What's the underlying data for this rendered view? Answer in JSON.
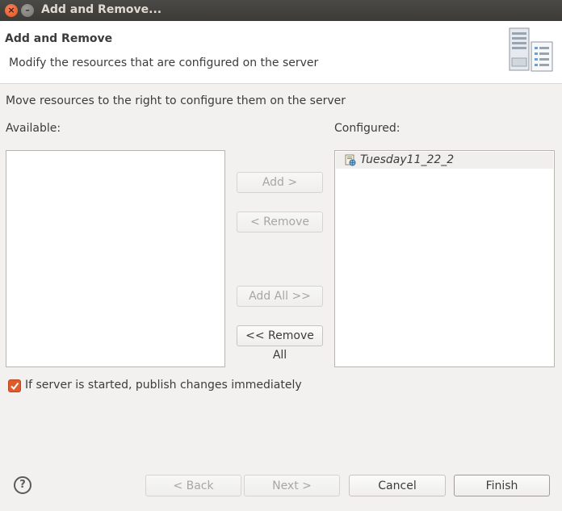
{
  "window": {
    "title": "Add and Remove..."
  },
  "header": {
    "title": "Add and Remove",
    "description": "Modify the resources that are configured on the server",
    "banner_icon": "server-wizard-icon"
  },
  "instruction": "Move resources to the right to configure them on the server",
  "available": {
    "label": "Available:",
    "items": []
  },
  "configured": {
    "label": "Configured:",
    "items": [
      {
        "label": "Tuesday11_22_2",
        "icon": "web-module-icon"
      }
    ]
  },
  "transfer_buttons": {
    "add": "Add >",
    "remove": "< Remove",
    "add_all": "Add All >>",
    "remove_all": "<< Remove All"
  },
  "publish_option": {
    "label": "If server is started, publish changes immediately",
    "checked": true
  },
  "footer": {
    "back": "< Back",
    "next": "Next >",
    "cancel": "Cancel",
    "finish": "Finish"
  },
  "colors": {
    "accent": "#e05a2b",
    "titlebar": "#3c3b37",
    "dialog_bg": "#f2f1f0"
  }
}
